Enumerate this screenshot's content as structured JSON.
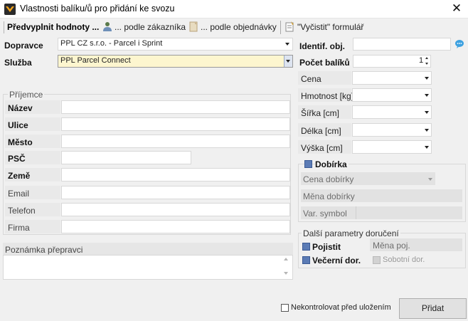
{
  "window": {
    "title": "Vlastnosti balíku/ů pro přidání ke svozu"
  },
  "toolbar": {
    "prefill_label": "Předvyplnit hodnoty ...",
    "by_customer_label": "... podle zákazníka",
    "by_order_label": "... podle objednávky",
    "clear_form_label": "\"Vyčistit\" formulář"
  },
  "carrier": {
    "dopravce_label": "Dopravce",
    "dopravce_value": "PPL CZ s.r.o. - Parcel i Sprint",
    "sluzba_label": "Služba",
    "sluzba_value": "PPL Parcel Connect"
  },
  "recipient": {
    "group_label": "Příjemce",
    "fields": {
      "nazev": "Název",
      "ulice": "Ulice",
      "mesto": "Město",
      "psc": "PSČ",
      "zeme": "Země",
      "email": "Email",
      "telefon": "Telefon",
      "firma": "Firma"
    }
  },
  "note": {
    "label": "Poznámka přepravci"
  },
  "package": {
    "identif_label": "Identif. obj.",
    "pocet_label": "Počet balíků",
    "pocet_value": "1",
    "cena_label": "Cena",
    "hmotnost_label": "Hmotnost [kg]",
    "sirka_label": "Šířka [cm]",
    "delka_label": "Délka [cm]",
    "vyska_label": "Výška [cm]"
  },
  "dobirka": {
    "label": "Dobírka",
    "cena_label": "Cena dobírky",
    "mena_label": "Měna dobírky",
    "var_symbol_label": "Var. symbol"
  },
  "delivery": {
    "group_label": "Další parametry doručení",
    "pojistit_label": "Pojistit",
    "mena_poj_label": "Měna poj.",
    "vecerni_label": "Večerní dor.",
    "sobotni_label": "Sobotní dor."
  },
  "footer": {
    "nekontrolovat_label": "Nekontrolovat před uložením",
    "pridat_label": "Přidat"
  },
  "colors": {
    "accent_blue": "#5b7bb5",
    "highlight_field": "#fdf6cf"
  }
}
